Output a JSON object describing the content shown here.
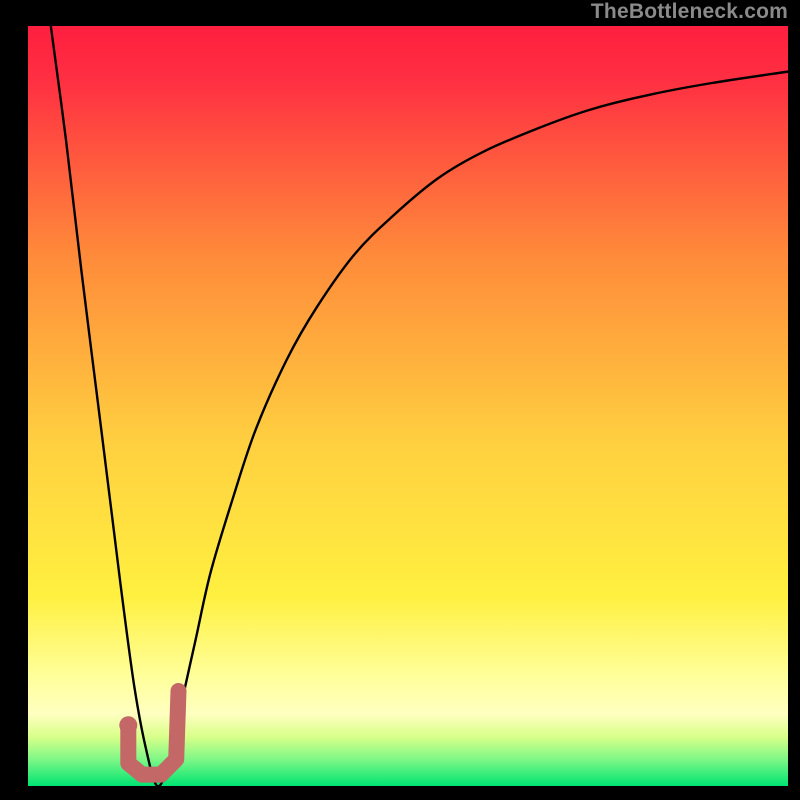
{
  "watermark": {
    "text": "TheBottleneck.com"
  },
  "colors": {
    "marker": "#c36767",
    "curve": "#000000",
    "gradient_top": "#ff1f3f",
    "gradient_mid": "#ffd040",
    "gradient_lightband": "#ffff9a",
    "gradient_bottom": "#00e472"
  },
  "chart_data": {
    "type": "line",
    "title": "",
    "xlabel": "",
    "ylabel": "",
    "xlim": [
      0,
      100
    ],
    "ylim": [
      0,
      100
    ],
    "series": [
      {
        "name": "bottleneck-curve",
        "x": [
          3,
          5,
          7,
          9,
          11,
          12.5,
          14,
          15.5,
          17,
          18.5,
          20,
          22,
          24,
          27,
          30,
          34,
          38,
          43,
          48,
          54,
          60,
          67,
          74,
          82,
          90,
          100
        ],
        "y": [
          100,
          85,
          68,
          52,
          36,
          24,
          13,
          5,
          0,
          3,
          10,
          19,
          28,
          38,
          47,
          56,
          63,
          70,
          75,
          80,
          83.5,
          86.5,
          89,
          91,
          92.5,
          94
        ]
      }
    ],
    "marker": {
      "name": "j-marker",
      "points_xy": [
        [
          13.2,
          8.0
        ],
        [
          13.2,
          3.0
        ],
        [
          15.0,
          1.5
        ],
        [
          17.5,
          1.5
        ],
        [
          19.5,
          3.5
        ],
        [
          19.8,
          12.5
        ]
      ],
      "dot_xy": [
        13.2,
        8.0
      ]
    }
  }
}
